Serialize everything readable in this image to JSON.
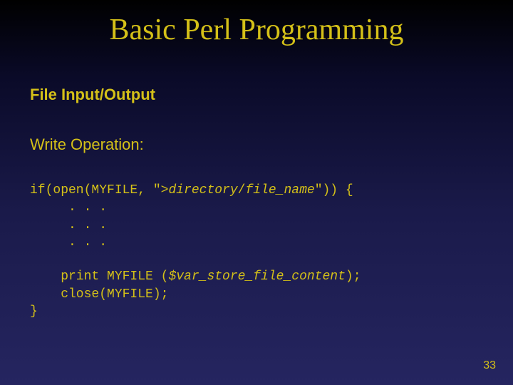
{
  "title": "Basic Perl Programming",
  "section": "File Input/Output",
  "subsection": "Write Operation:",
  "code": {
    "l1a": "if(open(MYFILE, \">",
    "l1b": "directory",
    "l1c": "/",
    "l1d": "file_name",
    "l1e": "\")) {",
    "l2": "     . . .",
    "l3": "     . . .",
    "l4": "     . . .",
    "l5": "",
    "l6a": "    print MYFILE (",
    "l6b": "$var_store_file_content",
    "l6c": ");",
    "l7": "    close(MYFILE);",
    "l8": "}"
  },
  "page_number": "33"
}
